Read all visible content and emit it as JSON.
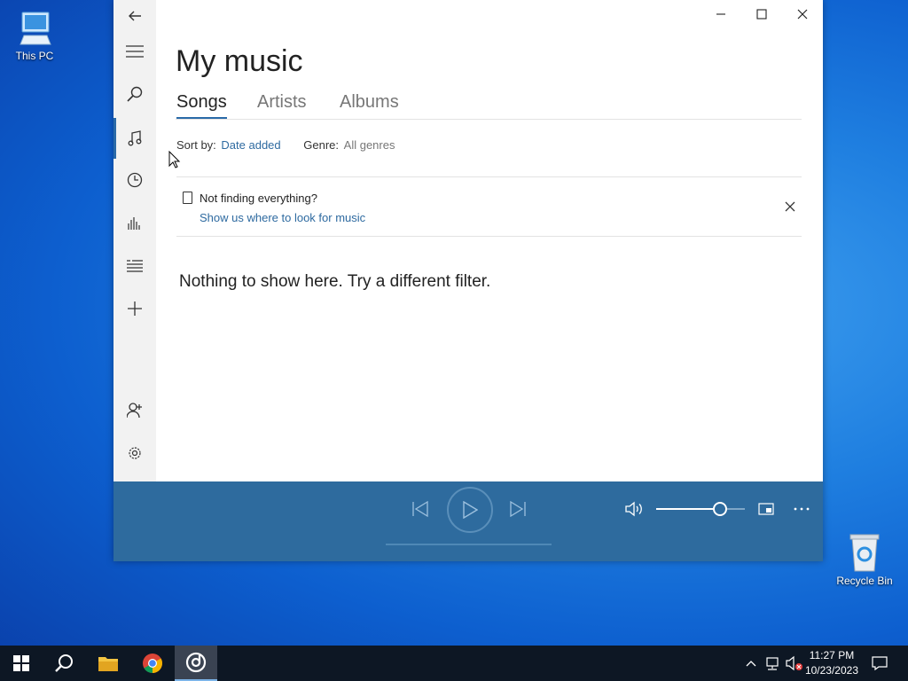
{
  "desktop": {
    "this_pc": "This PC",
    "recycle_bin": "Recycle Bin"
  },
  "sidebar": {
    "icons": [
      "back-arrow-icon",
      "hamburger-menu-icon",
      "search-icon",
      "music-note-icon",
      "recent-clock-icon",
      "now-playing-bars-icon",
      "playlists-icon",
      "add-icon",
      "add-user-icon",
      "settings-gear-icon"
    ],
    "active": "music-note-icon"
  },
  "main": {
    "title": "My music",
    "tabs": [
      {
        "label": "Songs",
        "active": true
      },
      {
        "label": "Artists",
        "active": false
      },
      {
        "label": "Albums",
        "active": false
      }
    ],
    "sort_label": "Sort by:",
    "sort_value": "Date added",
    "genre_label": "Genre:",
    "genre_value": "All genres",
    "notice_title": "Not finding everything?",
    "notice_link": "Show us where to look for music",
    "empty_message": "Nothing to show here. Try a different filter."
  },
  "player": {
    "volume_percent": 72,
    "accent": "#2e6b9e"
  },
  "taskbar": {
    "time": "11:27 PM",
    "date": "10/23/2023"
  }
}
